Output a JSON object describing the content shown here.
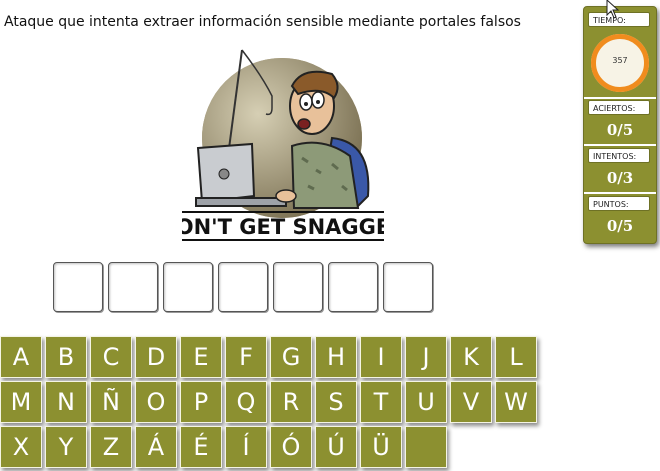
{
  "question": "Ataque que intenta extraer información sensible mediante portales falsos",
  "illustration": {
    "caption": "DON'T GET SNAGGED",
    "icon": "phishing-cartoon-image"
  },
  "answer": {
    "slots": 7
  },
  "keyboard": {
    "rows": [
      [
        "A",
        "B",
        "C",
        "D",
        "E",
        "F",
        "G",
        "H",
        "I",
        "J",
        "K",
        "L"
      ],
      [
        "M",
        "N",
        "Ñ",
        "O",
        "P",
        "Q",
        "R",
        "S",
        "T",
        "U",
        "V",
        "W"
      ],
      [
        "X",
        "Y",
        "Z",
        "Á",
        "É",
        "Í",
        "Ó",
        "Ú",
        "Ü",
        ""
      ]
    ],
    "key_color": "#8c9030"
  },
  "panel": {
    "timer_label": "TIEMPO:",
    "timer_value": "357",
    "hits_label": "ACIERTOS:",
    "hits_value": "0/5",
    "attempts_label": "INTENTOS:",
    "attempts_value": "0/3",
    "points_label": "PUNTOS:",
    "points_value": "0/5",
    "timer_ring_color": "#f08c1e"
  }
}
